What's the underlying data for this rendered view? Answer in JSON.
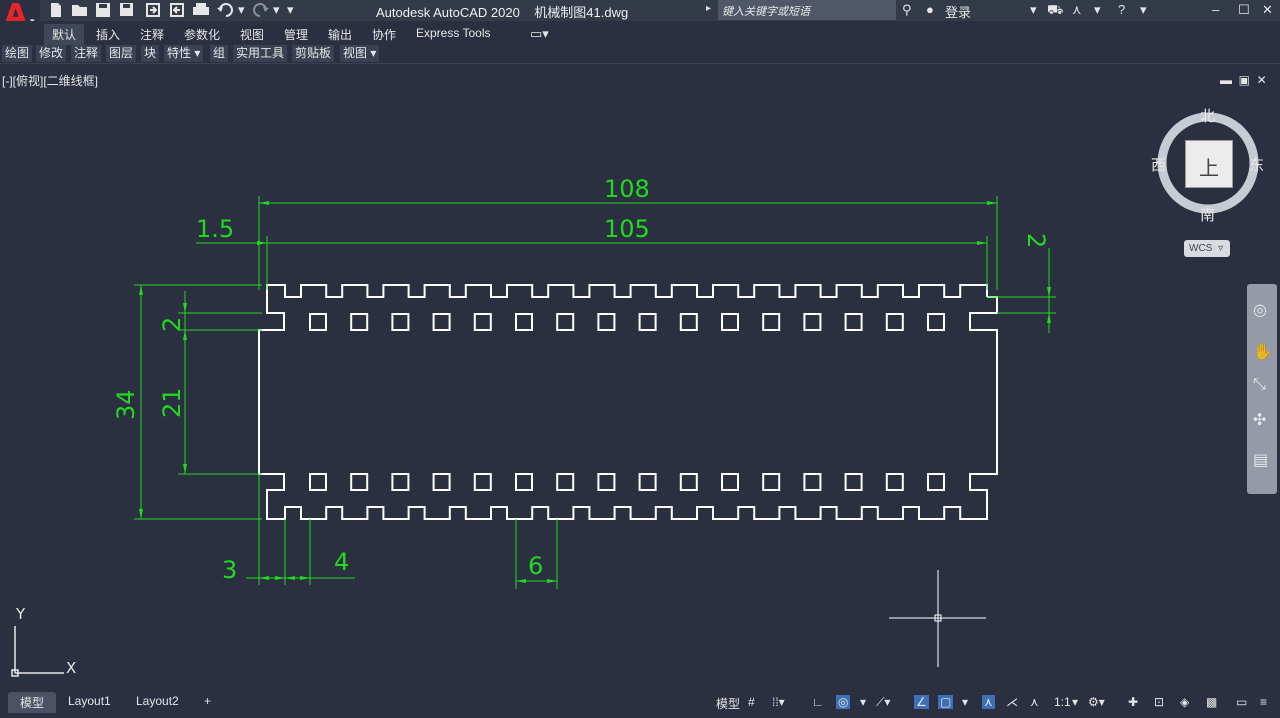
{
  "app": {
    "title": "Autodesk AutoCAD 2020",
    "file": "机械制图41.dwg",
    "logo_letter": "A"
  },
  "search": {
    "placeholder": "键入关键字或短语"
  },
  "user": {
    "signin_label": "登录"
  },
  "ribbon_tabs": [
    {
      "label": "默认",
      "active": true
    },
    {
      "label": "插入"
    },
    {
      "label": "注释"
    },
    {
      "label": "参数化"
    },
    {
      "label": "视图"
    },
    {
      "label": "管理"
    },
    {
      "label": "输出"
    },
    {
      "label": "协作"
    },
    {
      "label": "Express Tools"
    }
  ],
  "ribbon_panels": [
    "绘图",
    "修改",
    "注释",
    "图层",
    "块",
    "特性 ▾",
    "组",
    "实用工具",
    "剪贴板",
    "视图 ▾"
  ],
  "viewport": {
    "label": "[-][俯视][二维线框]"
  },
  "viewcube": {
    "north": "北",
    "south": "南",
    "east": "东",
    "west": "西",
    "face": "上",
    "wcs": "WCS"
  },
  "drawing": {
    "dimensions": {
      "overall_length": "108",
      "inner_length": "105",
      "offset_left": "1.5",
      "right_notch": "2",
      "overall_height": "34",
      "inner_height": "21",
      "left_notch": "2",
      "edge_width": "3",
      "tooth_width": "4",
      "pitch": "6"
    },
    "ucs": {
      "x": "X",
      "y": "Y"
    },
    "colors": {
      "background": "#2b3040",
      "geometry": "#ffffff",
      "dimension": "#22d922"
    }
  },
  "layout_tabs": [
    {
      "label": "模型",
      "active": true
    },
    {
      "label": "Layout1"
    },
    {
      "label": "Layout2"
    },
    {
      "label": "+"
    }
  ],
  "status": {
    "model": "模型",
    "scale": "1:1"
  }
}
